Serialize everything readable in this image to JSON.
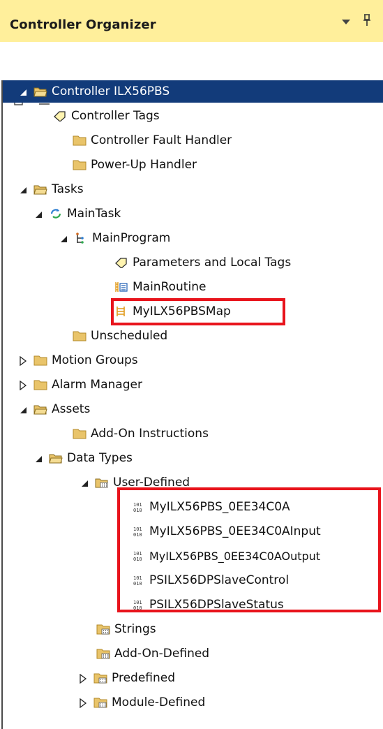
{
  "panel": {
    "title": "Controller Organizer"
  },
  "tree": {
    "controller": "Controller ILX56PBS",
    "controller_tags": "Controller Tags",
    "controller_fault_handler": "Controller Fault Handler",
    "power_up_handler": "Power-Up Handler",
    "tasks": "Tasks",
    "main_task": "MainTask",
    "main_program": "MainProgram",
    "parameters_local_tags": "Parameters and Local Tags",
    "main_routine": "MainRoutine",
    "map_routine": "MyILX56PBSMap",
    "unscheduled": "Unscheduled",
    "motion_groups": "Motion Groups",
    "alarm_manager": "Alarm Manager",
    "assets": "Assets",
    "add_on_instructions": "Add-On Instructions",
    "data_types": "Data Types",
    "user_defined": "User-Defined",
    "udts": [
      "MyILX56PBS_0EE34C0A",
      "MyILX56PBS_0EE34C0AInput",
      "MyILX56PBS_0EE34C0AOutput",
      "PSILX56DPSlaveControl",
      "PSILX56DPSlaveStatus"
    ],
    "strings": "Strings",
    "add_on_defined": "Add-On-Defined",
    "predefined": "Predefined",
    "module_defined": "Module-Defined"
  },
  "colors": {
    "header_bg": "#ffef9b",
    "selection_bg": "#123b7a",
    "highlight_border": "#e8141c",
    "folder": "#e9c46a",
    "folder_open_outline": "#7a7a7a"
  },
  "icons": {
    "collapse_all": "collapse-all-icon",
    "properties": "properties-list-icon",
    "folder": "folder-icon",
    "open_folder": "folder-open-icon",
    "tag": "tag-icon",
    "task": "task-cycle-icon",
    "program": "program-icon",
    "routine": "ladder-routine-icon",
    "map": "mapping-routine-icon",
    "udt": "binary-datatype-icon"
  }
}
